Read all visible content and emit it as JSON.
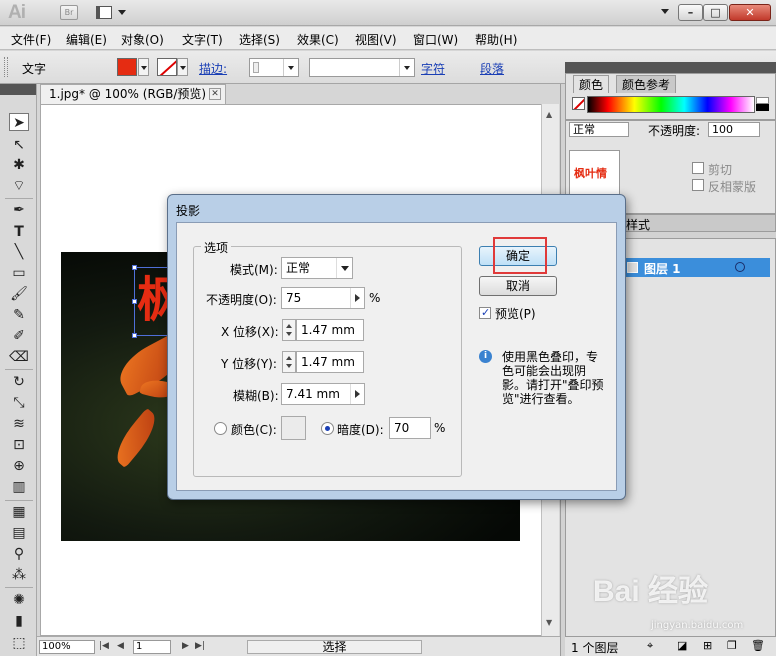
{
  "titlebar": {
    "app_logo": "Ai",
    "bridge_label": "Br"
  },
  "menu": [
    "文件(F)",
    "编辑(E)",
    "对象(O)",
    "文字(T)",
    "选择(S)",
    "效果(C)",
    "视图(V)",
    "窗口(W)",
    "帮助(H)"
  ],
  "control": {
    "tool_label": "文字",
    "fill_color": "#e52c12",
    "stroke_label": "描边:",
    "char_label": "字符",
    "para_label": "段落"
  },
  "document": {
    "tab_title": "1.jpg* @ 100% (RGB/预览)",
    "art_text": "枫",
    "zoom": "100%",
    "page": "1",
    "status_mode": "选择"
  },
  "panels": {
    "color_tab": "颜色",
    "color_ref_tab": "颜色参考",
    "blend_mode": "正常",
    "opacity_label": "不透明度:",
    "opacity_value": "100",
    "thumb_text": "枫叶情",
    "clip_label": "剪切",
    "invert_mask_label": "反相蒙版",
    "style_tab": "样式",
    "layer_name": "图层 1",
    "layer_count": "1 个图层"
  },
  "dialog": {
    "title": "投影",
    "group_title": "选项",
    "mode_label": "模式(M):",
    "mode_value": "正常",
    "opacity_label": "不透明度(O):",
    "opacity_value": "75",
    "opacity_unit": "%",
    "x_label": "X 位移(X):",
    "x_value": "1.47 mm",
    "y_label": "Y 位移(Y):",
    "y_value": "1.47 mm",
    "blur_label": "模糊(B):",
    "blur_value": "7.41 mm",
    "color_label": "颜色(C):",
    "darkness_label": "暗度(D):",
    "darkness_value": "70",
    "darkness_unit": "%",
    "ok_label": "确定",
    "cancel_label": "取消",
    "preview_label": "预览(P)",
    "info_text": "使用黑色叠印，专色可能会出现阴影。请打开\"叠印预览\"进行查看。"
  },
  "watermark": {
    "main": "Bai 经验",
    "sub": "jingyan.baidu.com"
  }
}
